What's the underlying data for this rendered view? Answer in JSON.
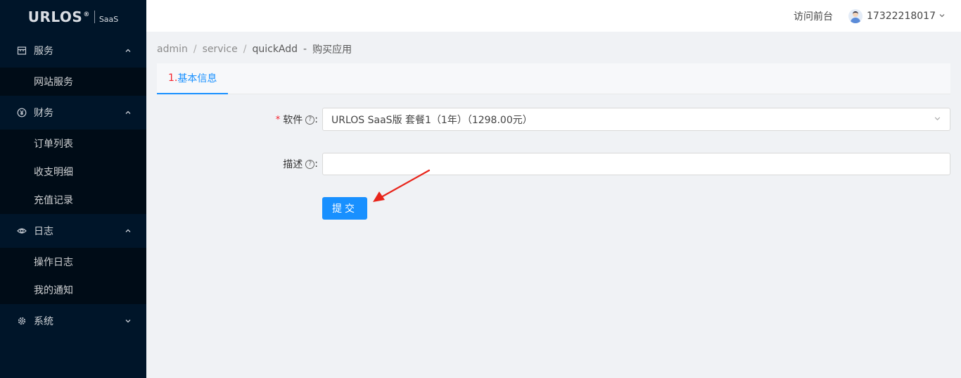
{
  "logo": {
    "name": "URLOS",
    "reg": "®",
    "edition": "SaaS"
  },
  "sidebar": {
    "groups": [
      {
        "label": "服务",
        "icon": "shop-icon",
        "expanded": true,
        "items": [
          {
            "label": "网站服务"
          }
        ]
      },
      {
        "label": "财务",
        "icon": "yuan-circle-icon",
        "expanded": true,
        "items": [
          {
            "label": "订单列表"
          },
          {
            "label": "收支明细"
          },
          {
            "label": "充值记录"
          }
        ]
      },
      {
        "label": "日志",
        "icon": "eye-icon",
        "expanded": true,
        "items": [
          {
            "label": "操作日志"
          },
          {
            "label": "我的通知"
          }
        ]
      },
      {
        "label": "系统",
        "icon": "gear-icon",
        "expanded": false,
        "items": []
      }
    ]
  },
  "header": {
    "visit_frontend": "访问前台",
    "username": "17322218017"
  },
  "breadcrumb": {
    "items": [
      "admin",
      "service",
      "quickAdd"
    ],
    "title": "购买应用"
  },
  "tabs": [
    {
      "num": "1.",
      "label": "基本信息"
    }
  ],
  "form": {
    "software": {
      "label": "软件",
      "colon": ":",
      "value": "URLOS SaaS版 套餐1（1年）（1298.00元）"
    },
    "description": {
      "label": "描述",
      "colon": ":",
      "value": "",
      "placeholder": ""
    },
    "submit_label": "提交"
  },
  "colors": {
    "sidebar_bg": "#001529",
    "submenu_bg": "#000c17",
    "primary": "#1890ff",
    "required": "#f5222d",
    "annotation_arrow": "#e8251b"
  }
}
